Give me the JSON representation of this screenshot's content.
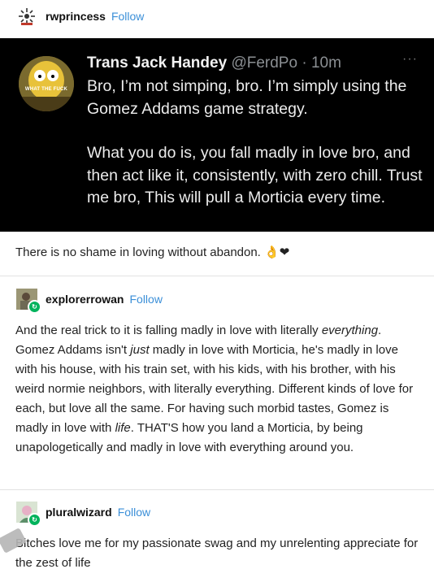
{
  "posts": [
    {
      "username": "rwprincess",
      "follow_label": "Follow",
      "tweet": {
        "name": "Trans Jack Handey",
        "handle": "@FerdPo",
        "time": "10m",
        "more": "···",
        "avatar_caption": "WHAT THE FUCK",
        "para1": "Bro, I’m not simping, bro. I’m simply using the Gomez Addams game strategy.",
        "para2": "What you do is, you fall madly in love bro, and then act like it, consistently, with zero chill. Trust me bro, This will pull a Morticia every time."
      },
      "caption": "There is no shame in loving without abandon. 👌❤"
    },
    {
      "username": "explorerrowan",
      "follow_label": "Follow",
      "body": {
        "s1": "And the real trick to it is falling madly in love with literally ",
        "s2": "everything",
        "s3": ". Gomez Addams isn't ",
        "s4": "just",
        "s5": " madly in love with Morticia, he's madly in love with his house, with his train set, with his kids, with his brother, with his weird normie neighbors, with literally everything. Different kinds of love for each, but love all the same. For having such morbid tastes, Gomez is madly in love with ",
        "s6": "life",
        "s7": ". THAT'S how you land a Morticia, by being unapologetically and madly in love with everything around you."
      }
    },
    {
      "username": "pluralwizard",
      "follow_label": "Follow",
      "body": "Bitches love me for my passionate swag and my unrelenting appreciate for the zest of life"
    }
  ]
}
